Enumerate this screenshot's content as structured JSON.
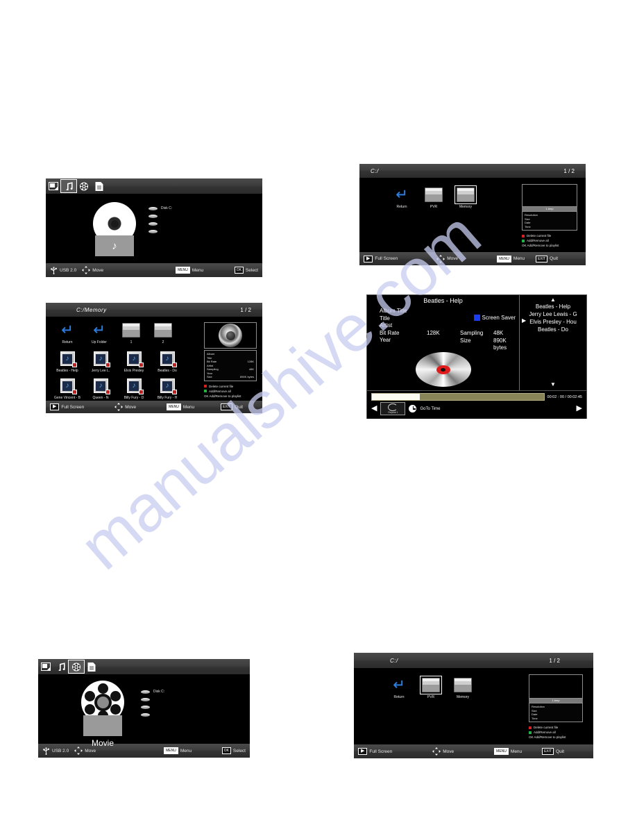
{
  "watermark": {
    "text": "manualshive.com"
  },
  "icons": {
    "photo": "photo-icon",
    "music": "music-note-icon",
    "movie": "film-reel-icon",
    "text": "text-file-icon",
    "return": "return-arrow-icon",
    "folder": "folder-icon",
    "usb": "usb-icon",
    "dpad": "dpad-icon",
    "play": "play-icon",
    "clock": "clock-icon",
    "speaker": "speaker-icon",
    "cd": "cd-disc-icon"
  },
  "common": {
    "status_home": {
      "usb": "USB 2.0",
      "move": "Move",
      "menu_key": "MENU",
      "menu": "Menu",
      "ok_key": "OK",
      "select": "Select"
    },
    "status_browser": {
      "play_key": "▶",
      "full_screen": "Full Screen",
      "move": "Move",
      "menu_key": "MENU",
      "menu": "Menu",
      "exit_key": "EXIT",
      "quit": "Quit"
    },
    "legend": [
      {
        "color": "#d42020",
        "label": "Delete current file"
      },
      {
        "color": "#22b340",
        "label": "Add/Remove all"
      },
      {
        "color": "",
        "label": "OK  Add/Remove to playlist"
      }
    ]
  },
  "panel_music_home": {
    "tabs": [
      {
        "name": "photo",
        "selected": false
      },
      {
        "name": "music",
        "selected": true
      },
      {
        "name": "movie",
        "selected": false
      },
      {
        "name": "text",
        "selected": false
      }
    ],
    "caption": "",
    "disks": [
      {
        "label": "Disk C:"
      },
      {
        "label": ""
      },
      {
        "label": ""
      },
      {
        "label": ""
      }
    ]
  },
  "panel_movie_home": {
    "tabs": [
      {
        "name": "photo",
        "selected": false
      },
      {
        "name": "music",
        "selected": false
      },
      {
        "name": "movie",
        "selected": true
      },
      {
        "name": "text",
        "selected": false
      }
    ],
    "caption": "Movie",
    "disks": [
      {
        "label": "Disk C:"
      },
      {
        "label": ""
      },
      {
        "label": ""
      },
      {
        "label": ""
      }
    ]
  },
  "panel_root_memory": {
    "path": "C:/",
    "page": "1 / 2",
    "items": [
      {
        "label": "Return",
        "kind": "return",
        "selected": false
      },
      {
        "label": "PVR",
        "kind": "folder",
        "selected": false
      },
      {
        "label": "Memory",
        "kind": "folder",
        "selected": true
      }
    ],
    "thumb_caption": "1.bmp",
    "meta": [
      {
        "key": "Resolution",
        "value": ""
      },
      {
        "key": "Size",
        "value": ""
      },
      {
        "key": "Date",
        "value": ""
      },
      {
        "key": "Time",
        "value": ""
      }
    ]
  },
  "panel_root_pvr": {
    "path": "C:/",
    "page": "1 / 2",
    "items": [
      {
        "label": "Return",
        "kind": "return",
        "selected": false
      },
      {
        "label": "PVR",
        "kind": "folder",
        "selected": true
      },
      {
        "label": "Memory",
        "kind": "folder",
        "selected": false
      }
    ],
    "thumb_caption": "1.bmp",
    "meta": [
      {
        "key": "Resolution",
        "value": ""
      },
      {
        "key": "Size",
        "value": ""
      },
      {
        "key": "Date",
        "value": ""
      },
      {
        "key": "Time",
        "value": ""
      }
    ]
  },
  "panel_file_browser": {
    "path": "C:/Memory",
    "page": "1 / 2",
    "folders": [
      {
        "label": "Return",
        "kind": "return"
      },
      {
        "label": "Up Folder",
        "kind": "return"
      },
      {
        "label": "1",
        "kind": "folder"
      },
      {
        "label": "2",
        "kind": "folder"
      }
    ],
    "files": [
      {
        "label": "Beatles - Help"
      },
      {
        "label": "Jerry Lee L."
      },
      {
        "label": "Elvis Presley"
      },
      {
        "label": "Beatles - Do"
      },
      {
        "label": "Gene Vincent - B"
      },
      {
        "label": "Queen - N"
      },
      {
        "label": "Billy Fury - D"
      },
      {
        "label": "Billy Fury - H"
      }
    ],
    "meta": [
      {
        "key": "Album",
        "value": ""
      },
      {
        "key": "Title",
        "value": ""
      },
      {
        "key": "Bit Rate",
        "value": "128K"
      },
      {
        "key": "Artist",
        "value": ""
      },
      {
        "key": "Sampling",
        "value": "48K"
      },
      {
        "key": "Year",
        "value": ""
      },
      {
        "key": "Size",
        "value": "890K bytes"
      }
    ]
  },
  "panel_player": {
    "now_playing_title": "Beatles - Help",
    "fields": [
      "Album Title",
      "Title",
      "Artist",
      "Bit Rate",
      "Year"
    ],
    "bit_rate_value": "128K",
    "right_labels": [
      "Sampling",
      "Size"
    ],
    "right_values": [
      "48K",
      "890K bytes"
    ],
    "screen_saver": "Screen Saver",
    "screen_saver_color": "#1a3df0",
    "playlist": [
      "Beatles - Help",
      "Jerry Lee Lewis - G",
      "Elvis Presley - Hou",
      "Beatles - Do"
    ],
    "playlist_current_index": 0,
    "scroll_up": "▲",
    "scroll_down": "▼",
    "cursor": "▶",
    "elapsed": "00:02 : 00",
    "separator": "/",
    "duration": "00:02:45",
    "time_display": "00:02 : 00 / 00:02:45",
    "progress_percent": 28,
    "repeat_label": "Repeat 1",
    "goto_time": "GoTo Time",
    "prev_arrow": "◀",
    "next_arrow": "▶"
  }
}
